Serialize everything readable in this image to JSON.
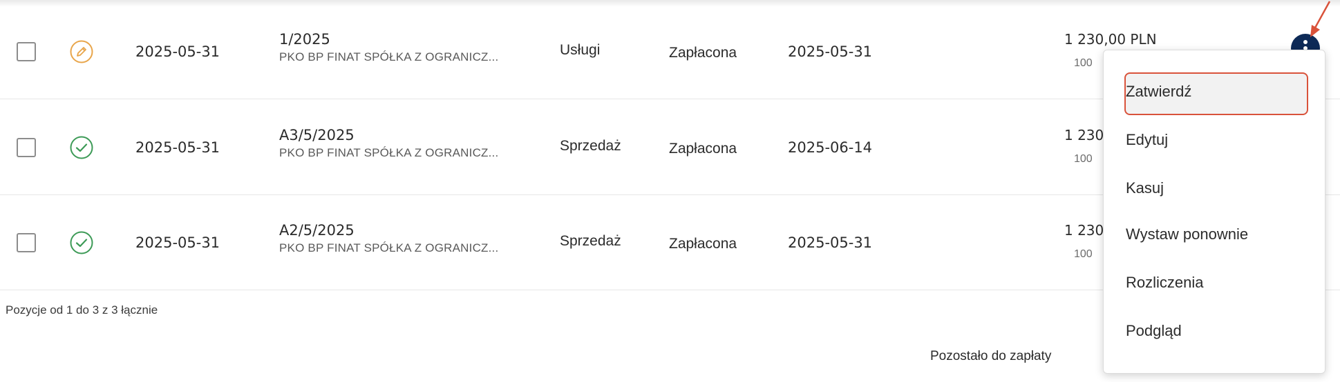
{
  "rows": [
    {
      "status_icon": "pencil-icon",
      "date": "2025-05-31",
      "doc_number": "1/2025",
      "contractor": "PKO BP FINAT SPÓŁKA Z OGRANICZ...",
      "category": "Usługi",
      "status": "Zapłacona",
      "payment_date": "2025-05-31",
      "amount": "1 230,00 PLN",
      "sub_amount": "100"
    },
    {
      "status_icon": "check-circle-icon",
      "date": "2025-05-31",
      "doc_number": "A3/5/2025",
      "contractor": "PKO BP FINAT SPÓŁKA Z OGRANICZ...",
      "category": "Sprzedaż",
      "status": "Zapłacona",
      "payment_date": "2025-06-14",
      "amount": "1 230",
      "sub_amount": "100"
    },
    {
      "status_icon": "check-circle-icon",
      "date": "2025-05-31",
      "doc_number": "A2/5/2025",
      "contractor": "PKO BP FINAT SPÓŁKA Z OGRANICZ...",
      "category": "Sprzedaż",
      "status": "Zapłacona",
      "payment_date": "2025-05-31",
      "amount": "1 230",
      "sub_amount": "100"
    }
  ],
  "pagination_info": "Pozycje od 1 do 3 z 3 łącznie",
  "remaining_label": "Pozostało do zapłaty",
  "context_menu": {
    "items": [
      "Zatwierdź",
      "Edytuj",
      "Kasuj",
      "Wystaw ponownie",
      "Rozliczenia",
      "Podgląd"
    ],
    "highlighted_index": 0
  },
  "colors": {
    "pencil_icon": "#e8a54a",
    "check_icon": "#3c9a56",
    "kebab_button": "#0d2a57",
    "highlight_border": "#d9523a",
    "arrow": "#d9523a"
  }
}
